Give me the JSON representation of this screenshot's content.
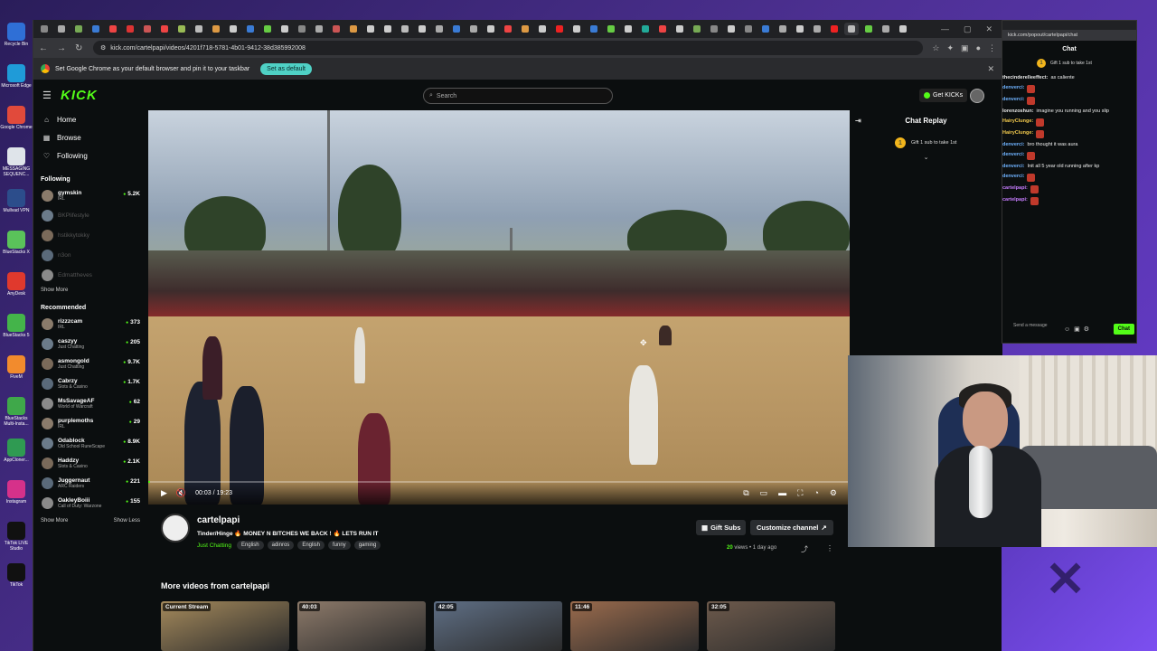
{
  "desktop": {
    "icons": [
      {
        "label": "Recycle Bin",
        "color": "#2f6fd6"
      },
      {
        "label": "Microsoft Edge",
        "color": "#1f9bd8"
      },
      {
        "label": "Google Chrome",
        "color": "#e14a3b"
      },
      {
        "label": "MESSAGING SEQUENC...",
        "color": "#dfe4ea"
      },
      {
        "label": "Mullvad VPN",
        "color": "#2c4d8b"
      },
      {
        "label": "BlueStacks X",
        "color": "#5ac25a"
      },
      {
        "label": "AnyDesk",
        "color": "#e0392d"
      },
      {
        "label": "BlueStacks 5",
        "color": "#44b44a"
      },
      {
        "label": "FiveM",
        "color": "#f28b2d"
      },
      {
        "label": "BlueStacks Multi-Insta...",
        "color": "#3fa84a"
      },
      {
        "label": "AppCloner...",
        "color": "#2f9a52"
      },
      {
        "label": "Instagram",
        "color": "#d6318a"
      },
      {
        "label": "TikTok LIVE Studio",
        "color": "#111111"
      },
      {
        "label": "TikTok",
        "color": "#111111"
      }
    ]
  },
  "browser": {
    "url": "kick.com/cartelpapi/videos/4201f718-5781-4b01-9412-38d385992008",
    "infobar": {
      "message": "Set Google Chrome as your default browser and pin it to your taskbar",
      "button": "Set as default"
    },
    "tab_colors": [
      "#888",
      "#aaa",
      "#7a5",
      "#3a7bd5",
      "#e44",
      "#d33",
      "#c55",
      "#e44",
      "#9b5",
      "#bbb",
      "#d94",
      "#ccc",
      "#3a7bd5",
      "#6c4",
      "#ccc",
      "#888",
      "#aaa",
      "#c55",
      "#d94",
      "#ccc",
      "#ccc",
      "#bbb",
      "#ccc",
      "#aaa",
      "#3a7bd5",
      "#aaa",
      "#ccc",
      "#e44",
      "#d94",
      "#ccc",
      "#e22",
      "#ccc",
      "#3a7bd5",
      "#6c4",
      "#ccc",
      "#2a9",
      "#e44",
      "#ccc",
      "#7a5",
      "#888",
      "#ccc",
      "#888",
      "#3a7bd5",
      "#aaa",
      "#ccc",
      "#aaa",
      "#e22",
      "#bbb",
      "#6c4",
      "#aaa",
      "#ccc"
    ]
  },
  "kick": {
    "logo": "KICK",
    "search_placeholder": "Search",
    "get_kicks": "Get KICKs",
    "nav": [
      {
        "label": "Home",
        "icon": "home-icon",
        "glyph": "⌂"
      },
      {
        "label": "Browse",
        "icon": "browse-icon",
        "glyph": "▦"
      },
      {
        "label": "Following",
        "icon": "heart-icon",
        "glyph": "♡"
      }
    ],
    "following_title": "Following",
    "following": [
      {
        "name": "gymskin",
        "sub": "IRL",
        "count": "5.2K",
        "online": true
      },
      {
        "name": "BKPlifestyle",
        "sub": "",
        "count": "",
        "online": false
      },
      {
        "name": "hstikkytokky",
        "sub": "",
        "count": "",
        "online": false
      },
      {
        "name": "n3on",
        "sub": "",
        "count": "",
        "online": false
      },
      {
        "name": "Edmattheves",
        "sub": "",
        "count": "",
        "online": false
      }
    ],
    "show_more": "Show More",
    "recommended_title": "Recommended",
    "recommended": [
      {
        "name": "rizzzcam",
        "sub": "IRL",
        "count": "373"
      },
      {
        "name": "caszyy",
        "sub": "Just Chatting",
        "count": "205"
      },
      {
        "name": "asmongold",
        "sub": "Just Chatting",
        "count": "9.7K"
      },
      {
        "name": "Cabrzy",
        "sub": "Slots & Casino",
        "count": "1.7K"
      },
      {
        "name": "MsSavageAF",
        "sub": "World of Warcraft",
        "count": "62"
      },
      {
        "name": "purplemoths",
        "sub": "IRL",
        "count": "29"
      },
      {
        "name": "Odablock",
        "sub": "Old School RuneScape",
        "count": "8.9K"
      },
      {
        "name": "Haddzy",
        "sub": "Slots & Casino",
        "count": "2.1K"
      },
      {
        "name": "Juggernaut",
        "sub": "ARC Raiders",
        "count": "221"
      },
      {
        "name": "OakleyBoiii",
        "sub": "Call of Duty: Warzone",
        "count": "155"
      }
    ],
    "footer_more": "Show More",
    "footer_less": "Show Less",
    "player": {
      "time": "00:03 / 19:23",
      "progress": 0.003
    },
    "chat_replay": {
      "title": "Chat Replay",
      "gift": "Gift 1 sub to take 1st"
    },
    "channel": {
      "name": "cartelpapi",
      "title": "Tinder/Hinge 🔥 MONEY N BITCHES WE BACK ! 🔥 LETS RUN IT",
      "category": "Just Chatting",
      "tags": [
        "English",
        "adinros",
        "English",
        "funny",
        "gaming"
      ],
      "gift_subs": "Gift Subs",
      "customize": "Customize channel",
      "views_count": "20",
      "views_label": "views • 1 day ago"
    },
    "more_videos_title": "More videos from cartelpapi",
    "more_videos": [
      {
        "badge": "Current Stream",
        "color": "#a58a5c"
      },
      {
        "badge": "40:03",
        "color": "#8d7a6a"
      },
      {
        "badge": "42:05",
        "color": "#5f6f85"
      },
      {
        "badge": "11:46",
        "color": "#9a6b4d"
      },
      {
        "badge": "32:05",
        "color": "#6d5a4c"
      }
    ]
  },
  "popout": {
    "url": "kick.com/popout/cartelpapi/chat",
    "title": "Chat",
    "gift": "Gift 1 sub to take 1st",
    "messages": [
      {
        "user": "thecinderelleeffect:",
        "text": "as caliente",
        "color": "#e8e8e8",
        "emote": false
      },
      {
        "user": "denverci:",
        "text": "",
        "color": "#6fb3ff",
        "emote": true
      },
      {
        "user": "denverci:",
        "text": "",
        "color": "#6fb3ff",
        "emote": true
      },
      {
        "user": "lorenzoshun:",
        "text": "imagine you running and you slip",
        "color": "#e8e8e8",
        "emote": false
      },
      {
        "user": "HairyClunge:",
        "text": "",
        "color": "#f2c94c",
        "emote": true
      },
      {
        "user": "HairyClunge:",
        "text": "",
        "color": "#f2c94c",
        "emote": true
      },
      {
        "user": "denverci:",
        "text": "bro thought it was aura",
        "color": "#6fb3ff",
        "emote": false
      },
      {
        "user": "denverci:",
        "text": "",
        "color": "#6fb3ff",
        "emote": true
      },
      {
        "user": "denverci:",
        "text": "Init all 5 year old running after kp",
        "color": "#6fb3ff",
        "emote": false
      },
      {
        "user": "denverci:",
        "text": "",
        "color": "#6fb3ff",
        "emote": true
      },
      {
        "user": "cartelpapi:",
        "text": "",
        "color": "#c77dff",
        "emote": true
      },
      {
        "user": "cartelpapi:",
        "text": "",
        "color": "#c77dff",
        "emote": true
      }
    ],
    "input_placeholder": "Send a message",
    "send": "Chat"
  }
}
